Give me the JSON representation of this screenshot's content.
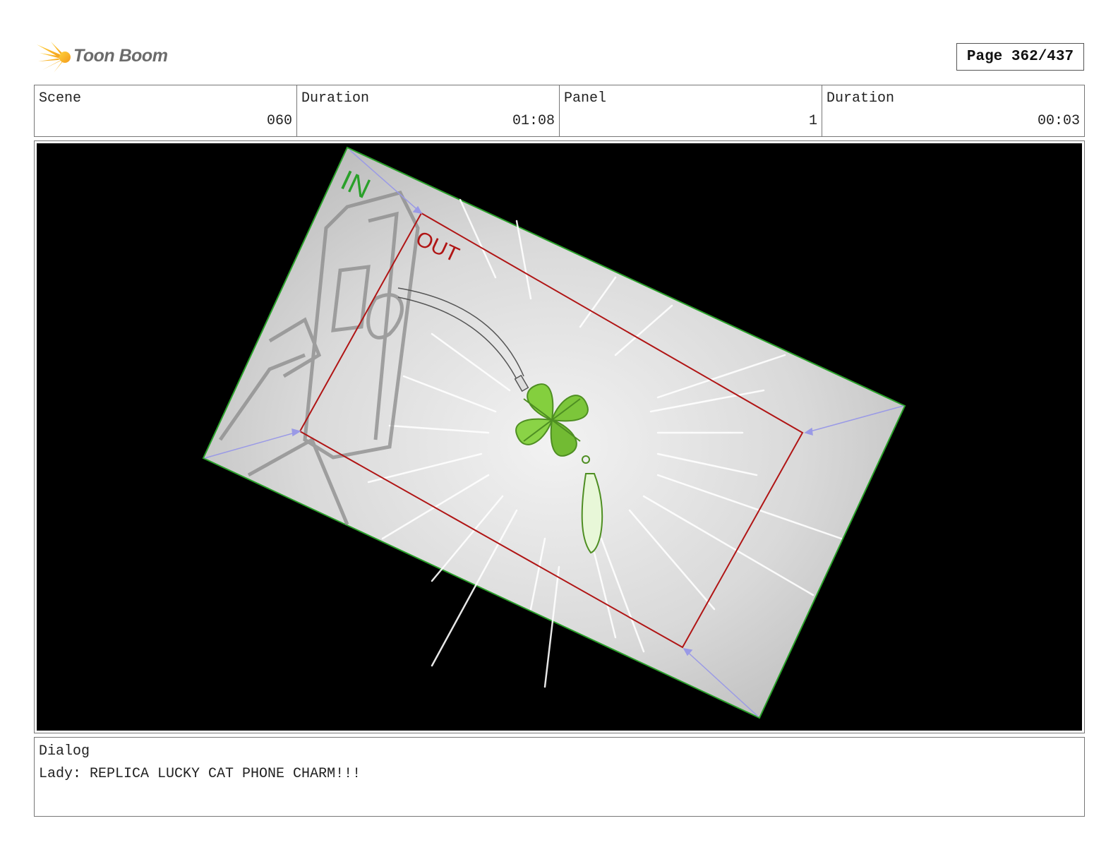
{
  "header": {
    "brand": "Toon Boom",
    "page_label": "Page 362/437"
  },
  "info": {
    "scene_label": "Scene",
    "scene_value": "060",
    "scene_duration_label": "Duration",
    "scene_duration_value": "01:08",
    "panel_label": "Panel",
    "panel_value": "1",
    "panel_duration_label": "Duration",
    "panel_duration_value": "00:03"
  },
  "panel": {
    "in_label": "IN",
    "out_label": "OUT",
    "colors": {
      "background": "#000000",
      "in_frame": "#2aa02a",
      "out_frame": "#b01515",
      "motion_arrows": "#9a9ae6",
      "charm": "#7cc63a"
    }
  },
  "dialog": {
    "label": "Dialog",
    "text": "Lady: REPLICA LUCKY CAT PHONE CHARM!!!"
  }
}
